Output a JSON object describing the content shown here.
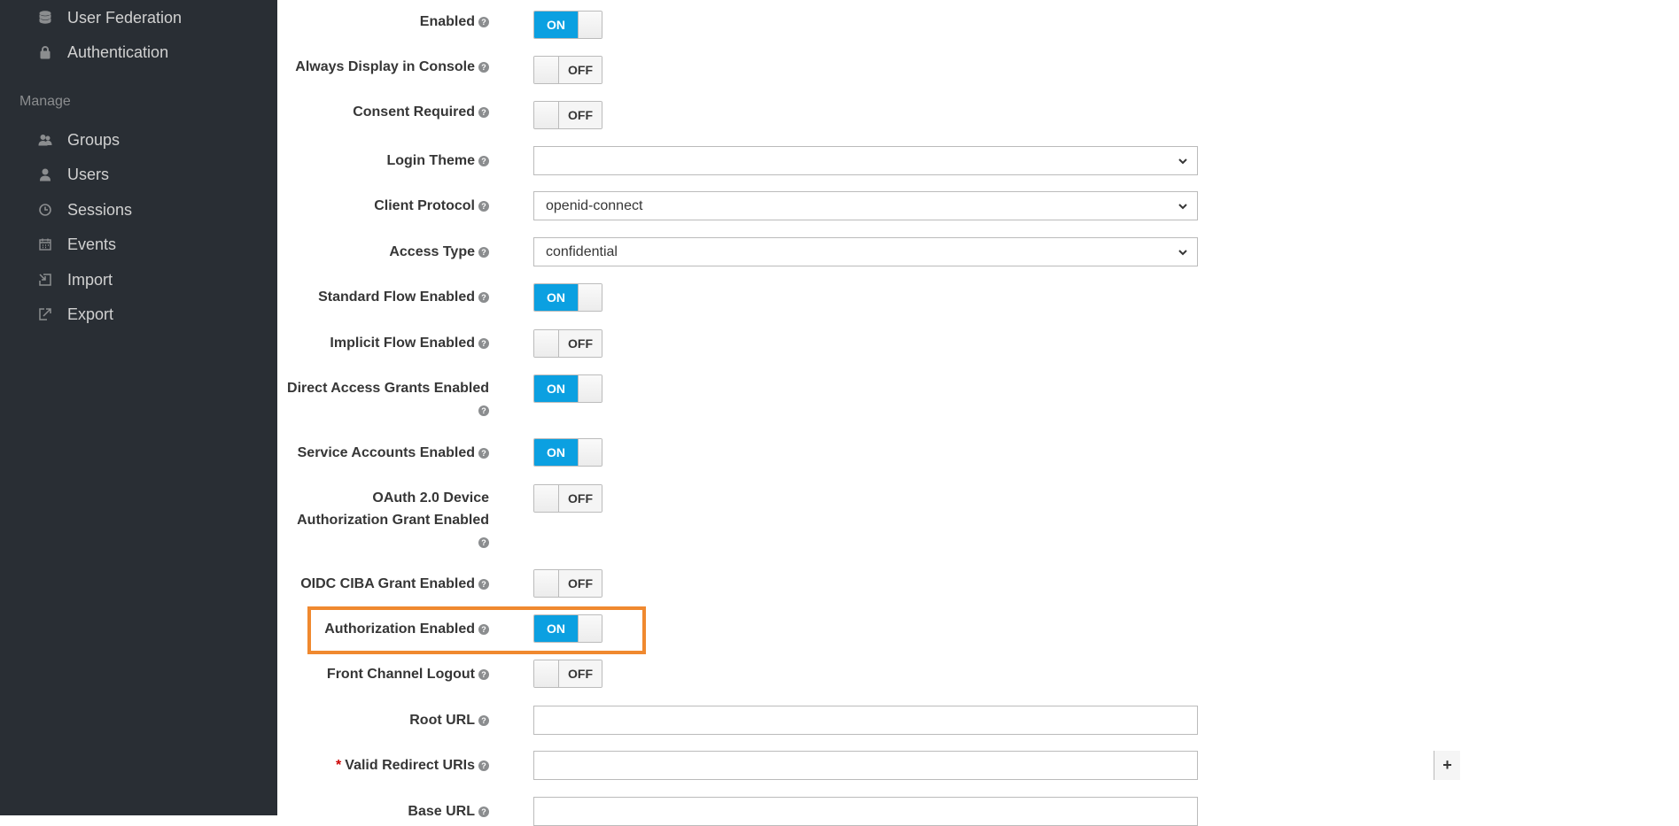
{
  "sidebar": {
    "top_items": [
      {
        "label": "User Federation",
        "icon": "database-icon"
      },
      {
        "label": "Authentication",
        "icon": "lock-icon"
      }
    ],
    "manage_heading": "Manage",
    "manage_items": [
      {
        "label": "Groups",
        "icon": "users-icon"
      },
      {
        "label": "Users",
        "icon": "user-icon"
      },
      {
        "label": "Sessions",
        "icon": "clock-icon"
      },
      {
        "label": "Events",
        "icon": "calendar-icon"
      },
      {
        "label": "Import",
        "icon": "import-icon"
      },
      {
        "label": "Export",
        "icon": "export-icon"
      }
    ]
  },
  "form": {
    "enabled": {
      "label": "Enabled",
      "state": "ON"
    },
    "always_display": {
      "label": "Always Display in Console",
      "state": "OFF"
    },
    "consent_required": {
      "label": "Consent Required",
      "state": "OFF"
    },
    "login_theme": {
      "label": "Login Theme",
      "value": ""
    },
    "client_protocol": {
      "label": "Client Protocol",
      "value": "openid-connect"
    },
    "access_type": {
      "label": "Access Type",
      "value": "confidential"
    },
    "standard_flow": {
      "label": "Standard Flow Enabled",
      "state": "ON"
    },
    "implicit_flow": {
      "label": "Implicit Flow Enabled",
      "state": "OFF"
    },
    "direct_access": {
      "label": "Direct Access Grants Enabled",
      "state": "ON"
    },
    "service_accounts": {
      "label": "Service Accounts Enabled",
      "state": "ON"
    },
    "oauth_device": {
      "label_line1": "OAuth 2.0 Device",
      "label_line2": "Authorization Grant Enabled",
      "state": "OFF"
    },
    "oidc_ciba": {
      "label": "OIDC CIBA Grant Enabled",
      "state": "OFF"
    },
    "authorization": {
      "label": "Authorization Enabled",
      "state": "ON"
    },
    "front_channel": {
      "label": "Front Channel Logout",
      "state": "OFF"
    },
    "root_url": {
      "label": "Root URL",
      "value": ""
    },
    "valid_redirect": {
      "label": "Valid Redirect URIs",
      "required_mark": "*",
      "value": "",
      "add_label": "+"
    },
    "base_url": {
      "label": "Base URL",
      "value": ""
    }
  },
  "colors": {
    "toggle_on": "#0ba0e1",
    "highlight": "#f0892f",
    "sidebar_bg": "#292e34"
  }
}
